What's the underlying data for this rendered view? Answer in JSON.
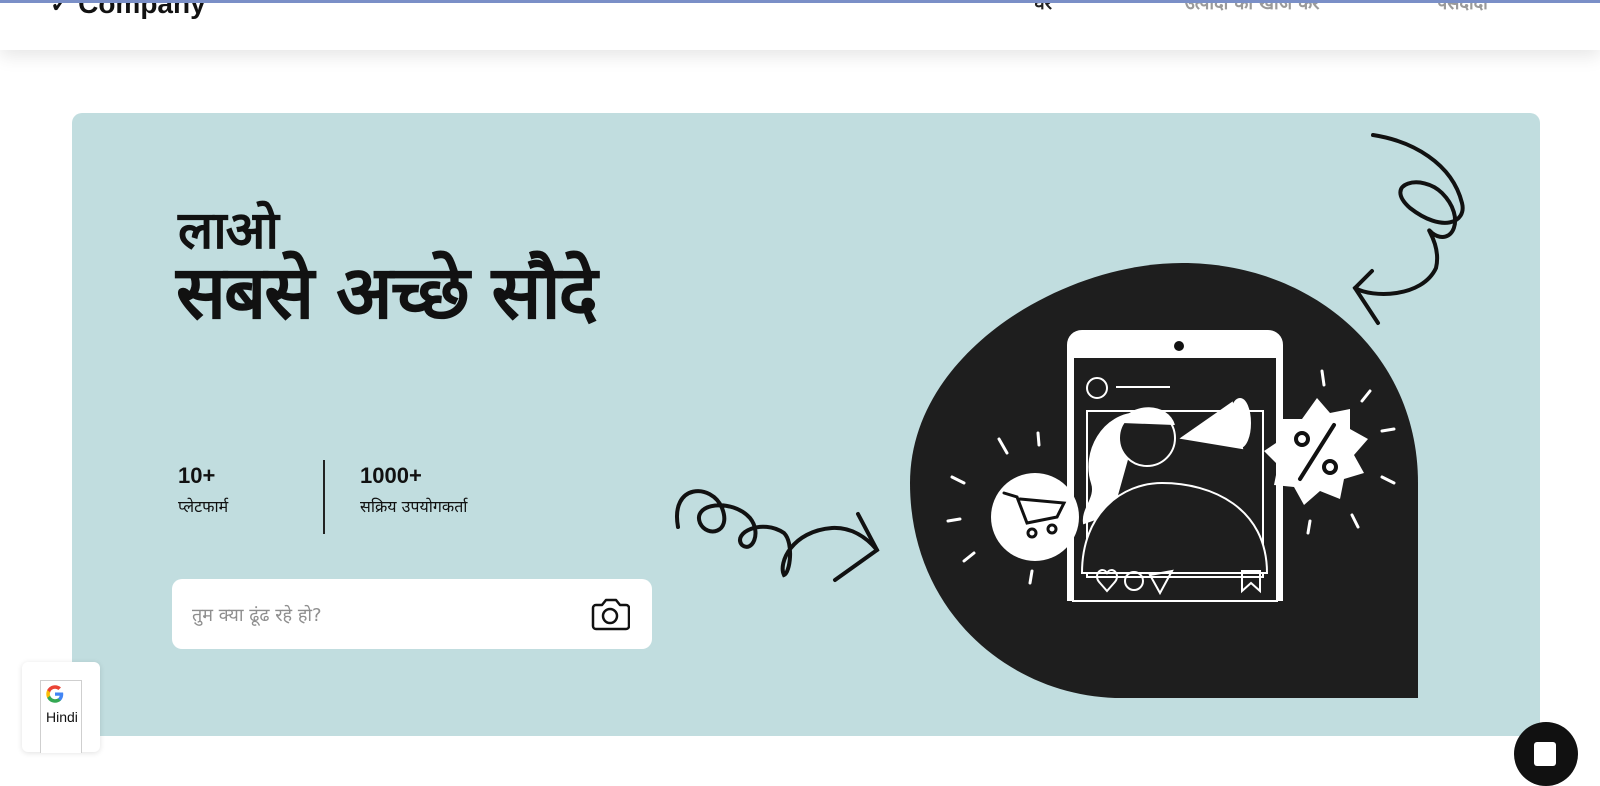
{
  "header": {
    "logo_text": "Company",
    "logo_icon": "checkmark-icon",
    "nav": [
      {
        "label": "घर"
      },
      {
        "label": "उत्पादों की खोज करें"
      },
      {
        "label": "पसंदीदा"
      }
    ]
  },
  "hero": {
    "headline_small": "लाओ",
    "headline_big": "सबसे अच्छे सौदे",
    "stats": [
      {
        "value": "10+",
        "label": "प्लेटफार्म"
      },
      {
        "value": "1000+",
        "label": "सक्रिय उपयोगकर्ता"
      }
    ],
    "search": {
      "placeholder": "तुम क्या ढूंढ रहे हो?",
      "value": "",
      "camera_icon": "camera-icon"
    },
    "illustration": "megaphone-phone-shopping-illustration",
    "colors": {
      "hero_bg": "#c1dddf",
      "blob": "#1e1e1e",
      "text": "#111111"
    }
  },
  "translate": {
    "icon": "google-g-icon",
    "language": "Hindi"
  },
  "chat": {
    "icon": "chat-icon"
  }
}
